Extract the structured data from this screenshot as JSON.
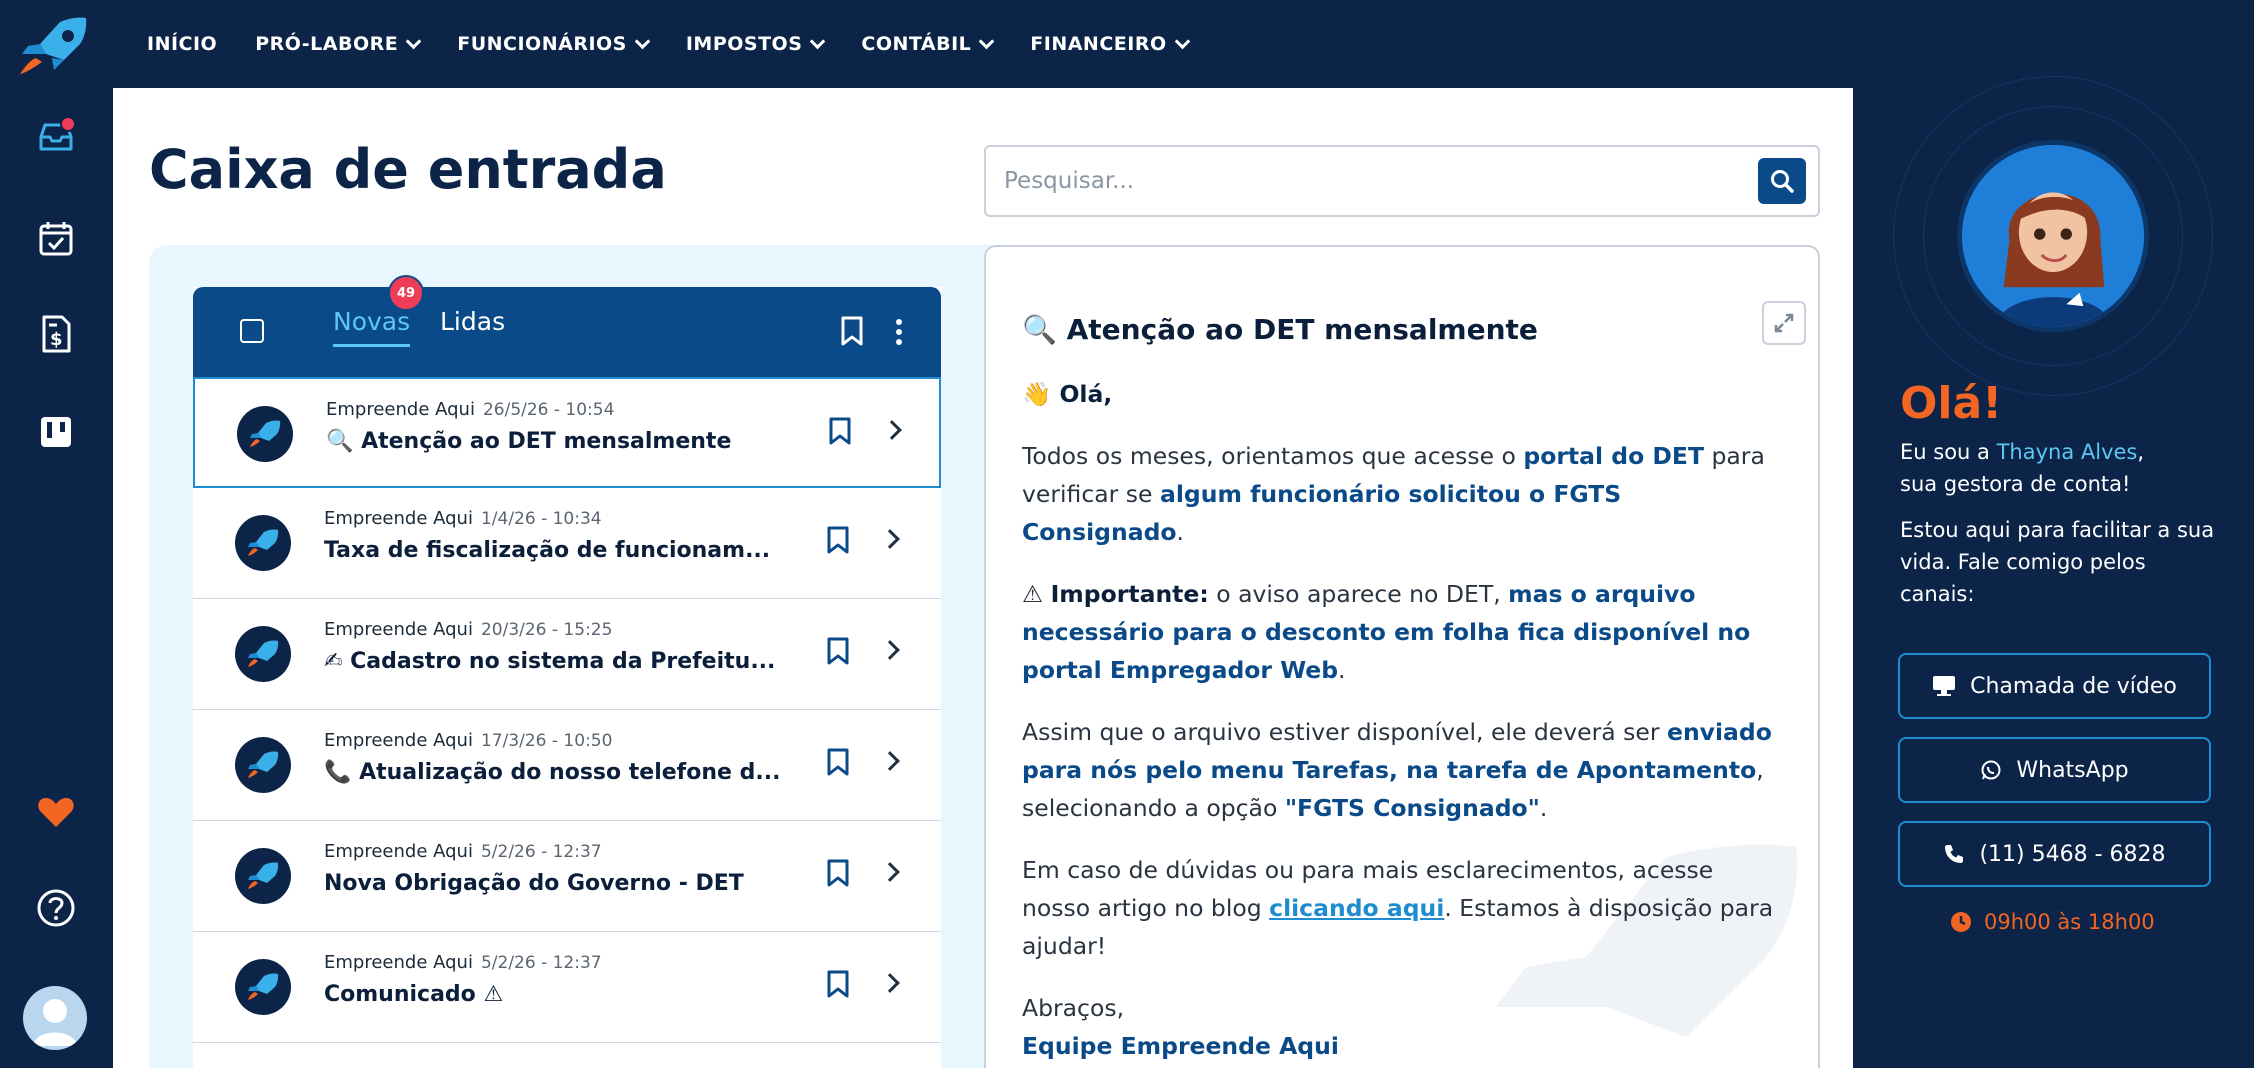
{
  "nav": {
    "items": [
      {
        "label": "INÍCIO",
        "dropdown": false
      },
      {
        "label": "PRÓ-LABORE",
        "dropdown": true
      },
      {
        "label": "FUNCIONÁRIOS",
        "dropdown": true
      },
      {
        "label": "IMPOSTOS",
        "dropdown": true
      },
      {
        "label": "CONTÁBIL",
        "dropdown": true
      },
      {
        "label": "FINANCEIRO",
        "dropdown": true
      }
    ]
  },
  "sidebar": {
    "icons": [
      "inbox-icon",
      "calendar-check-icon",
      "invoice-icon",
      "kanban-icon",
      "heart-icon",
      "help-icon",
      "user-avatar"
    ],
    "inbox_notification": true
  },
  "page": {
    "title": "Caixa de entrada",
    "search_placeholder": "Pesquisar..."
  },
  "inbox": {
    "tab_new": "Novas",
    "tab_read": "Lidas",
    "new_count": "49",
    "messages": [
      {
        "from": "Empreende Aqui",
        "date": "26/5/26 - 10:54",
        "emoji": "🔍",
        "subject": "Atenção ao DET mensalmente",
        "selected": true
      },
      {
        "from": "Empreende Aqui",
        "date": "1/4/26 - 10:34",
        "emoji": "",
        "subject": "Taxa de fiscalização de funcionam...",
        "selected": false
      },
      {
        "from": "Empreende Aqui",
        "date": "20/3/26 - 15:25",
        "emoji": "✍",
        "subject": "Cadastro no sistema da Prefeitu...",
        "selected": false
      },
      {
        "from": "Empreende Aqui",
        "date": "17/3/26 - 10:50",
        "emoji": "📞",
        "subject": "Atualização do nosso telefone d...",
        "selected": false
      },
      {
        "from": "Empreende Aqui",
        "date": "5/2/26 - 12:37",
        "emoji": "",
        "subject": "Nova Obrigação do Governo - DET",
        "selected": false
      },
      {
        "from": "Empreende Aqui",
        "date": "5/2/26 - 12:37",
        "emoji": "",
        "subject": "Comunicado ⚠",
        "selected": false
      }
    ]
  },
  "reader": {
    "title": "🔍 Atenção ao DET mensalmente",
    "greeting": "👋 Olá,",
    "p1_a": "Todos os meses, orientamos que acesse o ",
    "p1_link1": "portal do DET",
    "p1_b": " para verificar se ",
    "p1_link2": "algum funcionário solicitou o FGTS Consignado",
    "p1_c": ".",
    "p2_icon": "⚠",
    "p2_label": "Importante:",
    "p2_a": " o aviso aparece no DET, ",
    "p2_hl": "mas o arquivo necessário para o desconto em folha fica disponível no portal Empregador Web",
    "p2_b": ".",
    "p3_a": "Assim que o arquivo estiver disponível, ele deverá ser ",
    "p3_hl": "enviado para nós pelo menu Tarefas, na tarefa de Apontamento",
    "p3_b": ", selecionando a opção ",
    "p3_hl2": "\"FGTS Consignado\"",
    "p3_c": ".",
    "p4_a": "Em caso de dúvidas ou para mais esclarecimentos, acesse nosso artigo no blog ",
    "p4_link": "clicando aqui",
    "p4_b": ". Estamos à disposição para ajudar!",
    "closing": "Abraços,",
    "signature": "Equipe Empreende Aqui"
  },
  "manager": {
    "hello": "Olá!",
    "intro_a": "Eu sou a ",
    "name": "Thayna Alves",
    "intro_b": ",",
    "intro_c": "sua gestora de conta!",
    "help_text": "Estou aqui para facilitar a sua vida. Fale comigo pelos canais:",
    "video_label": "Chamada de vídeo",
    "whatsapp_label": "WhatsApp",
    "phone_label": "(11) 5468 - 6828",
    "hours": "09h00 às 18h00"
  },
  "colors": {
    "navy": "#0b2448",
    "blue": "#0b4a88",
    "cyan": "#5cc8f2",
    "orange": "#f26522",
    "badge": "#ef3d57"
  }
}
